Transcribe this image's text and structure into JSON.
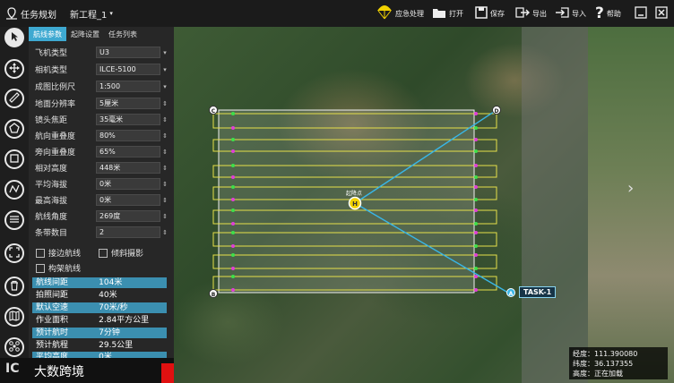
{
  "topbar": {
    "title": "任务规划",
    "project": "新工程_1",
    "emergency": "应急处理",
    "open": "打开",
    "save": "保存",
    "export": "导出",
    "import": "导入",
    "help": "帮助"
  },
  "panel": {
    "tabs": [
      "航线参数",
      "起降设置",
      "任务列表"
    ],
    "params": [
      {
        "label": "飞机类型",
        "value": "U3"
      },
      {
        "label": "相机类型",
        "value": "ILCE-5100"
      },
      {
        "label": "成图比例尺",
        "value": "1:500"
      },
      {
        "label": "地面分辨率",
        "value": "5厘米"
      },
      {
        "label": "镜头焦距",
        "value": "35毫米"
      },
      {
        "label": "航向重叠度",
        "value": "80%"
      },
      {
        "label": "旁向重叠度",
        "value": "65%"
      },
      {
        "label": "相对高度",
        "value": "448米"
      },
      {
        "label": "平均海拔",
        "value": "0米"
      },
      {
        "label": "最高海拔",
        "value": "0米"
      },
      {
        "label": "航线角度",
        "value": "269度"
      },
      {
        "label": "条带数目",
        "value": "2"
      }
    ],
    "checks": [
      "接边航线",
      "倾斜摄影",
      "构架航线"
    ],
    "stats": [
      {
        "label": "航线间距",
        "value": "104米"
      },
      {
        "label": "拍照间距",
        "value": "40米"
      },
      {
        "label": "默认空速",
        "value": "70米/秒"
      },
      {
        "label": "作业面积",
        "value": "2.84平方公里"
      },
      {
        "label": "预计航时",
        "value": "7分钟"
      },
      {
        "label": "预计航程",
        "value": "29.5公里"
      },
      {
        "label": "平均高度",
        "value": "0米"
      }
    ]
  },
  "logo": {
    "text": "大数跨境",
    "prefix": "IC"
  },
  "map": {
    "corner_c": "C",
    "corner_d": "D",
    "corner_b": "B",
    "corner_a": "A",
    "home": "H",
    "task_label": "TASK-1",
    "home_label": "起降点"
  },
  "coords": {
    "lon": "经度：111.390080",
    "lat": "纬度：36.137355",
    "alt": "高度：正在加载"
  },
  "colors": {
    "accent": "#3ea9d1",
    "route": "#e6e04a",
    "link": "#39b6e6"
  }
}
